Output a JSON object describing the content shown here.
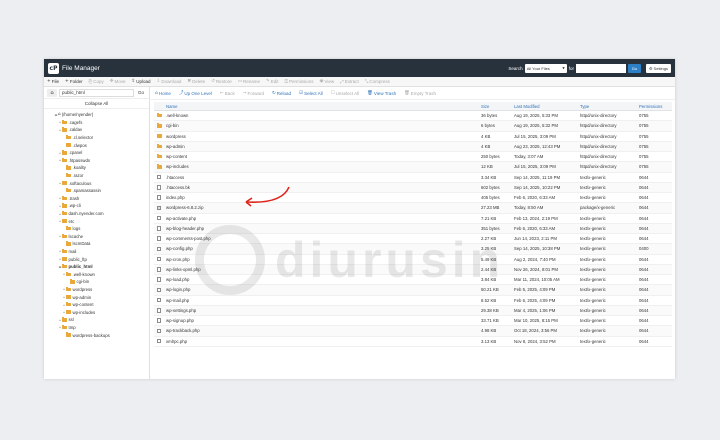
{
  "header": {
    "title": "File Manager",
    "logo": "cP",
    "search_label": "Search",
    "search_scope": "All Your Files",
    "search_for": "for",
    "go": "Go",
    "settings": "Settings"
  },
  "toolbar": [
    {
      "label": "File",
      "icon": "+",
      "on": true
    },
    {
      "label": "Folder",
      "icon": "+",
      "on": true
    },
    {
      "label": "Copy",
      "icon": "⎘",
      "on": false
    },
    {
      "label": "Move",
      "icon": "✥",
      "on": false
    },
    {
      "label": "Upload",
      "icon": "⇪",
      "on": true
    },
    {
      "label": "Download",
      "icon": "⇩",
      "on": false
    },
    {
      "label": "Delete",
      "icon": "✖",
      "on": false
    },
    {
      "label": "Restore",
      "icon": "↺",
      "on": false
    },
    {
      "label": "Rename",
      "icon": "▭",
      "on": false
    },
    {
      "label": "Edit",
      "icon": "✎",
      "on": false
    },
    {
      "label": "Permissions",
      "icon": "⚿",
      "on": false
    },
    {
      "label": "View",
      "icon": "◉",
      "on": false
    },
    {
      "label": "Extract",
      "icon": "⤢",
      "on": false
    },
    {
      "label": "Compress",
      "icon": "⤡",
      "on": false
    }
  ],
  "left": {
    "path": "public_html",
    "go": "Go",
    "collapse": "Collapse All",
    "tree": [
      {
        "label": "(/home/nyender)",
        "level": 0,
        "tw": "▬",
        "home": true
      },
      {
        "label": ".cagefs",
        "level": 1,
        "tw": "+"
      },
      {
        "label": ".caldav",
        "level": 1,
        "tw": "+"
      },
      {
        "label": ".cl.selector",
        "level": 2,
        "tw": ""
      },
      {
        "label": ".clwpos",
        "level": 2,
        "tw": ""
      },
      {
        "label": ".cpanel",
        "level": 1,
        "tw": "+"
      },
      {
        "label": ".htpasswds",
        "level": 1,
        "tw": "+"
      },
      {
        "label": ".koality",
        "level": 2,
        "tw": ""
      },
      {
        "label": ".razor",
        "level": 2,
        "tw": ""
      },
      {
        "label": ".softaculous",
        "level": 1,
        "tw": "+"
      },
      {
        "label": ".spamassassin",
        "level": 2,
        "tw": ""
      },
      {
        "label": ".trash",
        "level": 1,
        "tw": "+"
      },
      {
        "label": ".wp-cli",
        "level": 1,
        "tw": "+"
      },
      {
        "label": "dash.nyender.com",
        "level": 1,
        "tw": "+"
      },
      {
        "label": "etc",
        "level": 1,
        "tw": "+"
      },
      {
        "label": "logs",
        "level": 2,
        "tw": ""
      },
      {
        "label": "lscache",
        "level": 1,
        "tw": "+"
      },
      {
        "label": "lscmData",
        "level": 2,
        "tw": ""
      },
      {
        "label": "mail",
        "level": 1,
        "tw": "+"
      },
      {
        "label": "public_ftp",
        "level": 1,
        "tw": "+"
      },
      {
        "label": "public_html",
        "level": 1,
        "tw": "▬",
        "bold": true
      },
      {
        "label": ".well-known",
        "level": 2,
        "tw": "+"
      },
      {
        "label": "cgi-bin",
        "level": 3,
        "tw": ""
      },
      {
        "label": "wordpress",
        "level": 2,
        "tw": "+"
      },
      {
        "label": "wp-admin",
        "level": 2,
        "tw": "+"
      },
      {
        "label": "wp-content",
        "level": 2,
        "tw": "+"
      },
      {
        "label": "wp-includes",
        "level": 2,
        "tw": "+"
      },
      {
        "label": "ssl",
        "level": 1,
        "tw": "+"
      },
      {
        "label": "tmp",
        "level": 1,
        "tw": "+"
      },
      {
        "label": "wordpress-backups",
        "level": 2,
        "tw": ""
      }
    ]
  },
  "file_toolbar": [
    {
      "label": "Home",
      "icon": "⌂",
      "on": true
    },
    {
      "label": "Up One Level",
      "icon": "⤴",
      "on": true
    },
    {
      "label": "Back",
      "icon": "←",
      "on": false
    },
    {
      "label": "Forward",
      "icon": "→",
      "on": false
    },
    {
      "label": "Reload",
      "icon": "↻",
      "on": true
    },
    {
      "label": "Select All",
      "icon": "☑",
      "on": true
    },
    {
      "label": "Unselect All",
      "icon": "☐",
      "on": false
    },
    {
      "label": "View Trash",
      "icon": "🗑",
      "on": true
    },
    {
      "label": "Empty Trash",
      "icon": "🗑",
      "on": false
    }
  ],
  "columns": {
    "name": "Name",
    "size": "Size",
    "modified": "Last Modified",
    "type": "Type",
    "perms": "Permissions"
  },
  "files": [
    {
      "name": ".well-known",
      "size": "36 bytes",
      "modified": "Aug 19, 2025, 5:33 PM",
      "type": "httpd/unix-directory",
      "perms": "0755",
      "kind": "folder"
    },
    {
      "name": "cgi-bin",
      "size": "6 bytes",
      "modified": "Aug 19, 2025, 5:32 PM",
      "type": "httpd/unix-directory",
      "perms": "0755",
      "kind": "folder"
    },
    {
      "name": "wordpress",
      "size": "4 KB",
      "modified": "Jul 15, 2025, 3:09 PM",
      "type": "httpd/unix-directory",
      "perms": "0755",
      "kind": "folder"
    },
    {
      "name": "wp-admin",
      "size": "4 KB",
      "modified": "Aug 23, 2025, 12:43 PM",
      "type": "httpd/unix-directory",
      "perms": "0755",
      "kind": "folder"
    },
    {
      "name": "wp-content",
      "size": "250 bytes",
      "modified": "Today, 3:07 AM",
      "type": "httpd/unix-directory",
      "perms": "0755",
      "kind": "folder"
    },
    {
      "name": "wp-includes",
      "size": "12 KB",
      "modified": "Jul 15, 2025, 3:09 PM",
      "type": "httpd/unix-directory",
      "perms": "0755",
      "kind": "folder"
    },
    {
      "name": ".htaccess",
      "size": "3.34 KB",
      "modified": "Sep 14, 2025, 11:19 PM",
      "type": "text/x-generic",
      "perms": "0644",
      "kind": "file"
    },
    {
      "name": ".htaccess.bk",
      "size": "602 bytes",
      "modified": "Sep 14, 2025, 10:22 PM",
      "type": "text/x-generic",
      "perms": "0644",
      "kind": "file"
    },
    {
      "name": "index.php",
      "size": "405 bytes",
      "modified": "Feb 6, 2020, 6:33 AM",
      "type": "text/x-generic",
      "perms": "0644",
      "kind": "file"
    },
    {
      "name": "wordpress-6.8.2.zip",
      "size": "27.23 MB",
      "modified": "Today, 8:50 AM",
      "type": "package/x-generic",
      "perms": "0644",
      "kind": "zip"
    },
    {
      "name": "wp-activate.php",
      "size": "7.21 KB",
      "modified": "Feb 13, 2024, 2:19 PM",
      "type": "text/x-generic",
      "perms": "0644",
      "kind": "file"
    },
    {
      "name": "wp-blog-header.php",
      "size": "351 bytes",
      "modified": "Feb 6, 2020, 6:33 AM",
      "type": "text/x-generic",
      "perms": "0644",
      "kind": "file"
    },
    {
      "name": "wp-comments-post.php",
      "size": "2.27 KB",
      "modified": "Jun 14, 2023, 2:11 PM",
      "type": "text/x-generic",
      "perms": "0644",
      "kind": "file"
    },
    {
      "name": "wp-config.php",
      "size": "3.25 KB",
      "modified": "Sep 14, 2025, 10:38 PM",
      "type": "text/x-generic",
      "perms": "0400",
      "kind": "file"
    },
    {
      "name": "wp-cron.php",
      "size": "5.49 KB",
      "modified": "Aug 2, 2024, 7:40 PM",
      "type": "text/x-generic",
      "perms": "0644",
      "kind": "file"
    },
    {
      "name": "wp-links-opml.php",
      "size": "2.44 KB",
      "modified": "Nov 26, 2024, 8:01 PM",
      "type": "text/x-generic",
      "perms": "0644",
      "kind": "file"
    },
    {
      "name": "wp-load.php",
      "size": "3.84 KB",
      "modified": "Mar 11, 2024, 10:05 AM",
      "type": "text/x-generic",
      "perms": "0644",
      "kind": "file"
    },
    {
      "name": "wp-login.php",
      "size": "50.21 KB",
      "modified": "Feb 5, 2025, 4:09 PM",
      "type": "text/x-generic",
      "perms": "0644",
      "kind": "file"
    },
    {
      "name": "wp-mail.php",
      "size": "8.52 KB",
      "modified": "Feb 6, 2025, 4:09 PM",
      "type": "text/x-generic",
      "perms": "0644",
      "kind": "file"
    },
    {
      "name": "wp-settings.php",
      "size": "29.38 KB",
      "modified": "Mar 4, 2025, 1:06 PM",
      "type": "text/x-generic",
      "perms": "0644",
      "kind": "file"
    },
    {
      "name": "wp-signup.php",
      "size": "33.71 KB",
      "modified": "Mar 10, 2025, 8:15 PM",
      "type": "text/x-generic",
      "perms": "0644",
      "kind": "file"
    },
    {
      "name": "wp-trackback.php",
      "size": "4.98 KB",
      "modified": "Oct 18, 2024, 3:56 PM",
      "type": "text/x-generic",
      "perms": "0644",
      "kind": "file"
    },
    {
      "name": "xmlrpc.php",
      "size": "3.13 KB",
      "modified": "Nov 8, 2024, 3:52 PM",
      "type": "text/x-generic",
      "perms": "0644",
      "kind": "file"
    }
  ],
  "watermark": "diurusin"
}
